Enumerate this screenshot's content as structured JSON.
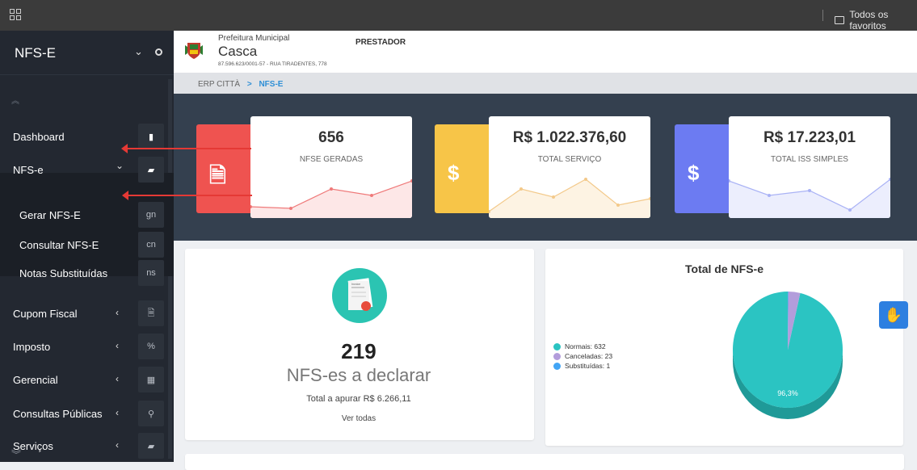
{
  "topbar": {
    "favorites_label": "Todos os favoritos"
  },
  "sidebar": {
    "brand": "NFS-E",
    "items": [
      {
        "label": "Dashboard",
        "icon": "file-icon",
        "glyph": "▮",
        "arrow": ""
      },
      {
        "label": "NFS-e",
        "icon": "book-icon",
        "glyph": "▰",
        "arrow": "⌄"
      },
      {
        "label": "Gerar NFS-E",
        "icon": "gn",
        "glyph": "gn",
        "arrow": ""
      },
      {
        "label": "Consultar NFS-E",
        "icon": "cn",
        "glyph": "cn",
        "arrow": ""
      },
      {
        "label": "Notas Substituídas",
        "icon": "ns",
        "glyph": "ns",
        "arrow": ""
      },
      {
        "label": "Cupom Fiscal",
        "icon": "document-icon",
        "glyph": "🗎",
        "arrow": "‹"
      },
      {
        "label": "Imposto",
        "icon": "percent-icon",
        "glyph": "%",
        "arrow": "‹"
      },
      {
        "label": "Gerencial",
        "icon": "table-icon",
        "glyph": "▦",
        "arrow": "‹"
      },
      {
        "label": "Consultas Públicas",
        "icon": "search-icon",
        "glyph": "⚲",
        "arrow": "‹"
      },
      {
        "label": "Serviços",
        "icon": "book-icon",
        "glyph": "▰",
        "arrow": "‹"
      }
    ]
  },
  "header": {
    "line1": "Prefeitura Municipal",
    "city": "Casca",
    "address": "87.596.623/0001-57 - RUA TIRADENTES, 778",
    "role": "PRESTADOR"
  },
  "breadcrumb": {
    "root": "ERP CITTÀ",
    "sep": ">",
    "current": "NFS-E"
  },
  "stats": [
    {
      "value": "656",
      "caption": "NFSE GERADAS",
      "color": "#ef5350",
      "fill": "#fde7e7",
      "line": "#ef7a7a",
      "glyph": "🗎"
    },
    {
      "value": "R$ 1.022.376,60",
      "caption": "TOTAL SERVIÇO",
      "color": "#f7c548",
      "fill": "#fdf3e3",
      "line": "#f3c98a",
      "glyph": "$"
    },
    {
      "value": "R$ 17.223,01",
      "caption": "TOTAL ISS SIMPLES",
      "color": "#6c7bf2",
      "fill": "#eceefd",
      "line": "#a9b2f5",
      "glyph": "$"
    }
  ],
  "declare": {
    "count": "219",
    "label": "NFS-es a declarar",
    "total": "Total a apurar R$ 6.266,11",
    "link": "Ver todas",
    "icon_text": "Invoice"
  },
  "chart_data": {
    "type": "pie",
    "title": "Total de NFS-e",
    "categories": [
      "Normais: 632",
      "Canceladas: 23",
      "Substituídas: 1"
    ],
    "values": [
      632,
      23,
      1
    ],
    "colors": [
      "#2bc4c2",
      "#b39ddb",
      "#42a5f5"
    ],
    "data_label": "96,3%",
    "legend": "left"
  }
}
